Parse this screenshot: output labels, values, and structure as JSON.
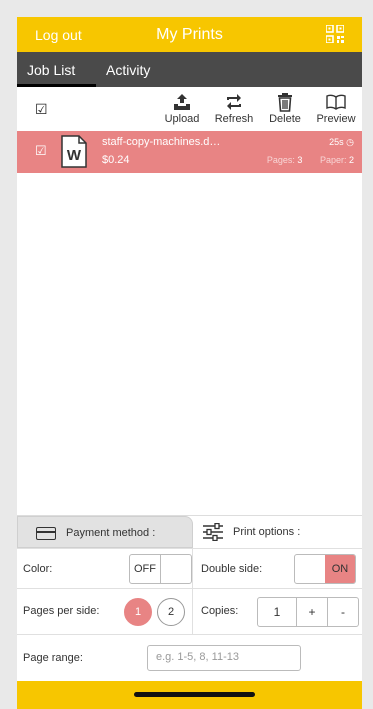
{
  "header": {
    "logout_label": "Log out",
    "title": "My Prints",
    "bg_color": "#f7c600"
  },
  "tabs": [
    {
      "label": "Job List"
    },
    {
      "label": "Activity"
    }
  ],
  "toolbar": {
    "upload_label": "Upload",
    "refresh_label": "Refresh",
    "delete_label": "Delete",
    "preview_label": "Preview"
  },
  "jobs": [
    {
      "name": "staff-copy-machines.d…",
      "price": "$0.24",
      "time": "25s",
      "pages_label": "Pages:",
      "pages": "3",
      "paper_label": "Paper:",
      "paper": "2",
      "icon": "word-doc-icon",
      "row_color": "#e88484"
    }
  ],
  "options": {
    "payment_label": "Payment method :",
    "print_label": "Print options :",
    "color_label": "Color:",
    "color_off": "OFF",
    "double_side_label": "Double side:",
    "double_side_on": "ON",
    "pages_per_side_label": "Pages per side:",
    "pages_per_side_options": [
      "1",
      "2"
    ],
    "pages_per_side_selected": "1",
    "copies_label": "Copies:",
    "copies_value": "1",
    "copies_plus": "+",
    "copies_minus": "-",
    "page_range_label": "Page range:",
    "page_range_placeholder": "e.g. 1-5, 8, 11-13"
  }
}
